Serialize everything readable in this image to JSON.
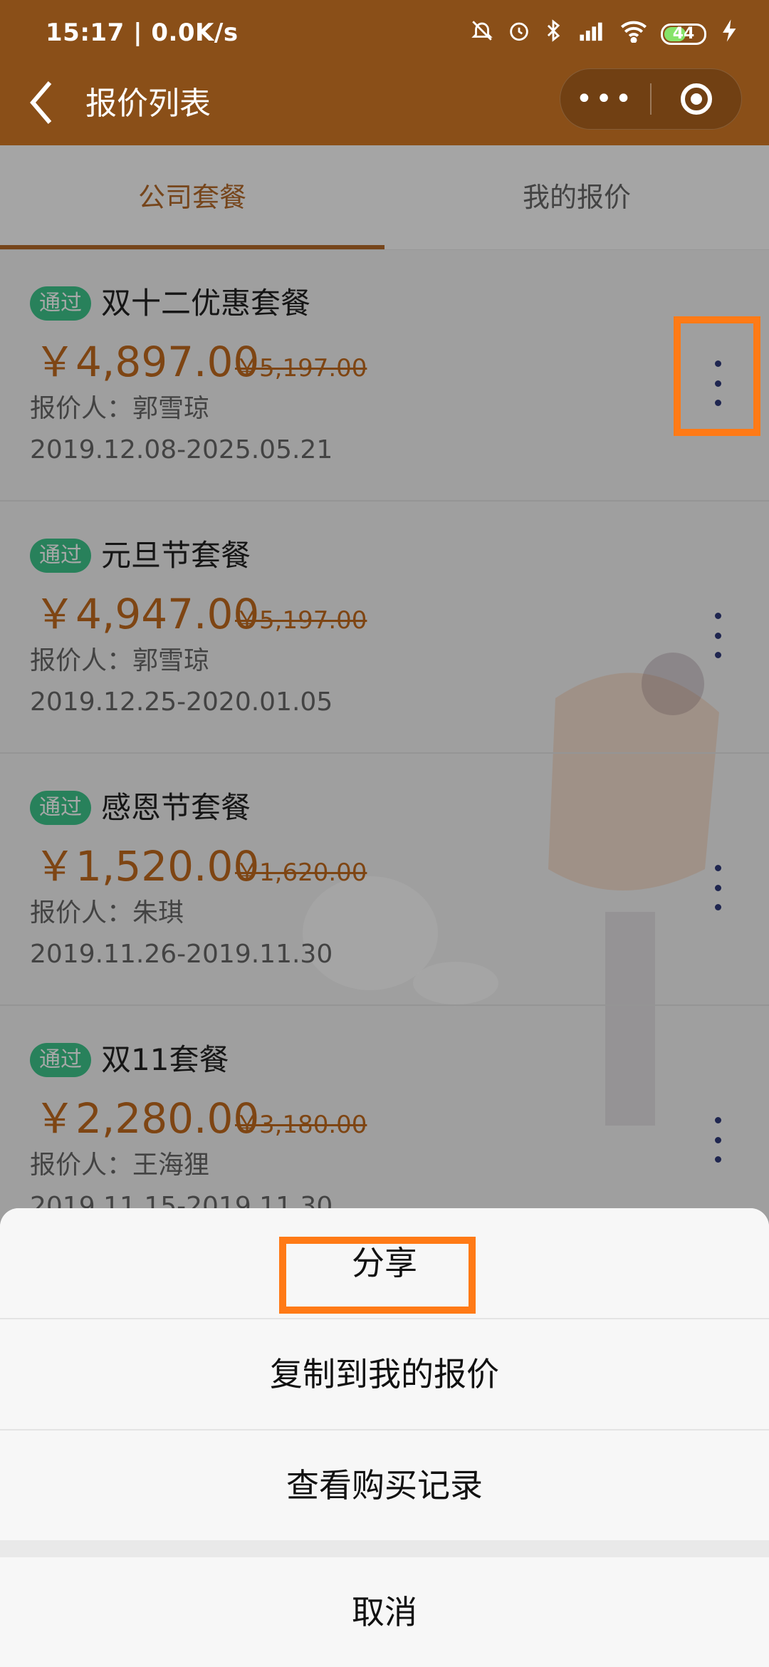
{
  "status_bar": {
    "time_speed": "15:17 | 0.0K/s",
    "battery_level": "44",
    "icons": [
      "mute-bell-icon",
      "alarm-icon",
      "bluetooth-icon",
      "hd-signal-icon",
      "wifi-icon",
      "battery-icon",
      "charging-icon"
    ]
  },
  "header": {
    "back_icon": "‹",
    "title": "报价列表",
    "more_dots": "•••"
  },
  "tabs": [
    {
      "label": "公司套餐",
      "active": true
    },
    {
      "label": "我的报价",
      "active": false
    }
  ],
  "items": [
    {
      "badge": "通过",
      "title": "双十二优惠套餐",
      "price": "￥4,897.00",
      "old_price": "￥5,197.00",
      "quoter": "报价人：郭雪琼",
      "dates": "2019.12.08-2025.05.21"
    },
    {
      "badge": "通过",
      "title": "元旦节套餐",
      "price": "￥4,947.00",
      "old_price": "￥5,197.00",
      "quoter": "报价人：郭雪琼",
      "dates": "2019.12.25-2020.01.05"
    },
    {
      "badge": "通过",
      "title": "感恩节套餐",
      "price": "￥1,520.00",
      "old_price": "￥1,620.00",
      "quoter": "报价人：朱琪",
      "dates": "2019.11.26-2019.11.30"
    },
    {
      "badge": "通过",
      "title": "双11套餐",
      "price": "￥2,280.00",
      "old_price": "￥3,180.00",
      "quoter": "报价人：王海狸",
      "dates": "2019.11.15-2019.11.30"
    }
  ],
  "action_sheet": {
    "options": [
      "分享",
      "复制到我的报价",
      "查看购买记录"
    ],
    "cancel": "取消"
  },
  "colors": {
    "header_bg": "#8a4f18",
    "accent": "#b36a2a",
    "price": "#c06a1e",
    "badge": "#3ec48b",
    "highlight": "#ff7a16"
  }
}
